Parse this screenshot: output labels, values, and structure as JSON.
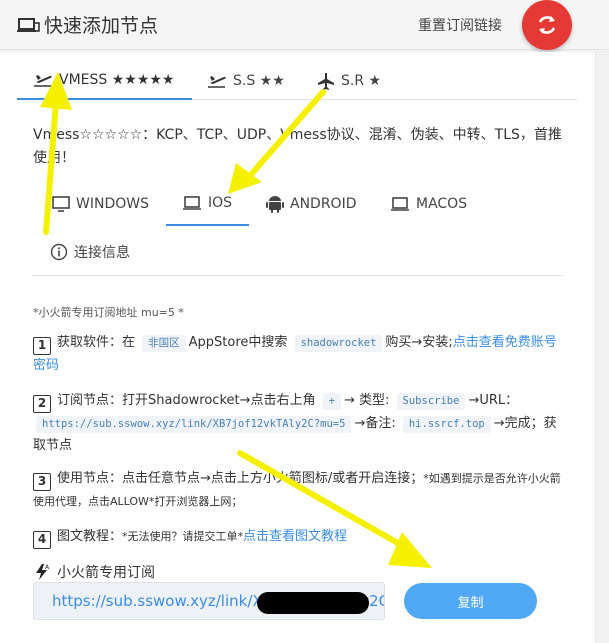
{
  "header": {
    "title": "快速添加节点",
    "reset_label": "重置订阅链接"
  },
  "protocol_tabs": [
    {
      "label": "VMESS ★★★★★"
    },
    {
      "label": "S.S ★★"
    },
    {
      "label": "S.R ★"
    }
  ],
  "description": "Vmess☆☆☆☆☆：KCP、TCP、UDP、Vmess协议、混淆、伪装、中转、TLS，首推使用！",
  "os_tabs": [
    {
      "label": "WINDOWS"
    },
    {
      "label": "IOS"
    },
    {
      "label": "ANDROID"
    },
    {
      "label": "MACOS"
    }
  ],
  "info_tab": "连接信息",
  "note": "*小火箭专用订阅地址 mu=5 *",
  "steps": {
    "s1": {
      "num": "1",
      "a": "获取软件：在",
      "code1": "非国区",
      "b": "AppStore中搜索",
      "code2": "shadowrocket",
      "c": "购买→安装;",
      "link": "点击查看免费账号密码"
    },
    "s2": {
      "num": "2",
      "a": "订阅节点：打开Shadowrocket→点击右上角",
      "code1": "+",
      "b": "→ 类型:",
      "code2": "Subscribe",
      "c": "→URL：",
      "code3": "https://sub.sswow.xyz/link/XB7jof12vkTAly2C?mu=5",
      "d": "→备注:",
      "code4": "hi.ssrcf.top",
      "e": "→完成；获取节点"
    },
    "s3": {
      "num": "3",
      "a": "使用节点：点击任意节点→点击上方小火箭图标/或者开启连接；",
      "small": "*如遇到提示是否允许小火箭使用代理，点击ALLOW*打开浏览器上网；"
    },
    "s4": {
      "num": "4",
      "a": "图文教程：",
      "small": "*无法使用？请提交工单*",
      "link": "点击查看图文教程"
    }
  },
  "subscription": {
    "label": "小火箭专用订阅",
    "url": "https://sub.sswow.xyz/link/XB7jof12vkTAly2C?mu=5",
    "copy_label": "复制"
  },
  "colors": {
    "accent": "#3a8ee6",
    "refresh": "#e53935",
    "copy_button": "#51a8f5",
    "arrow": "#f5f000"
  }
}
